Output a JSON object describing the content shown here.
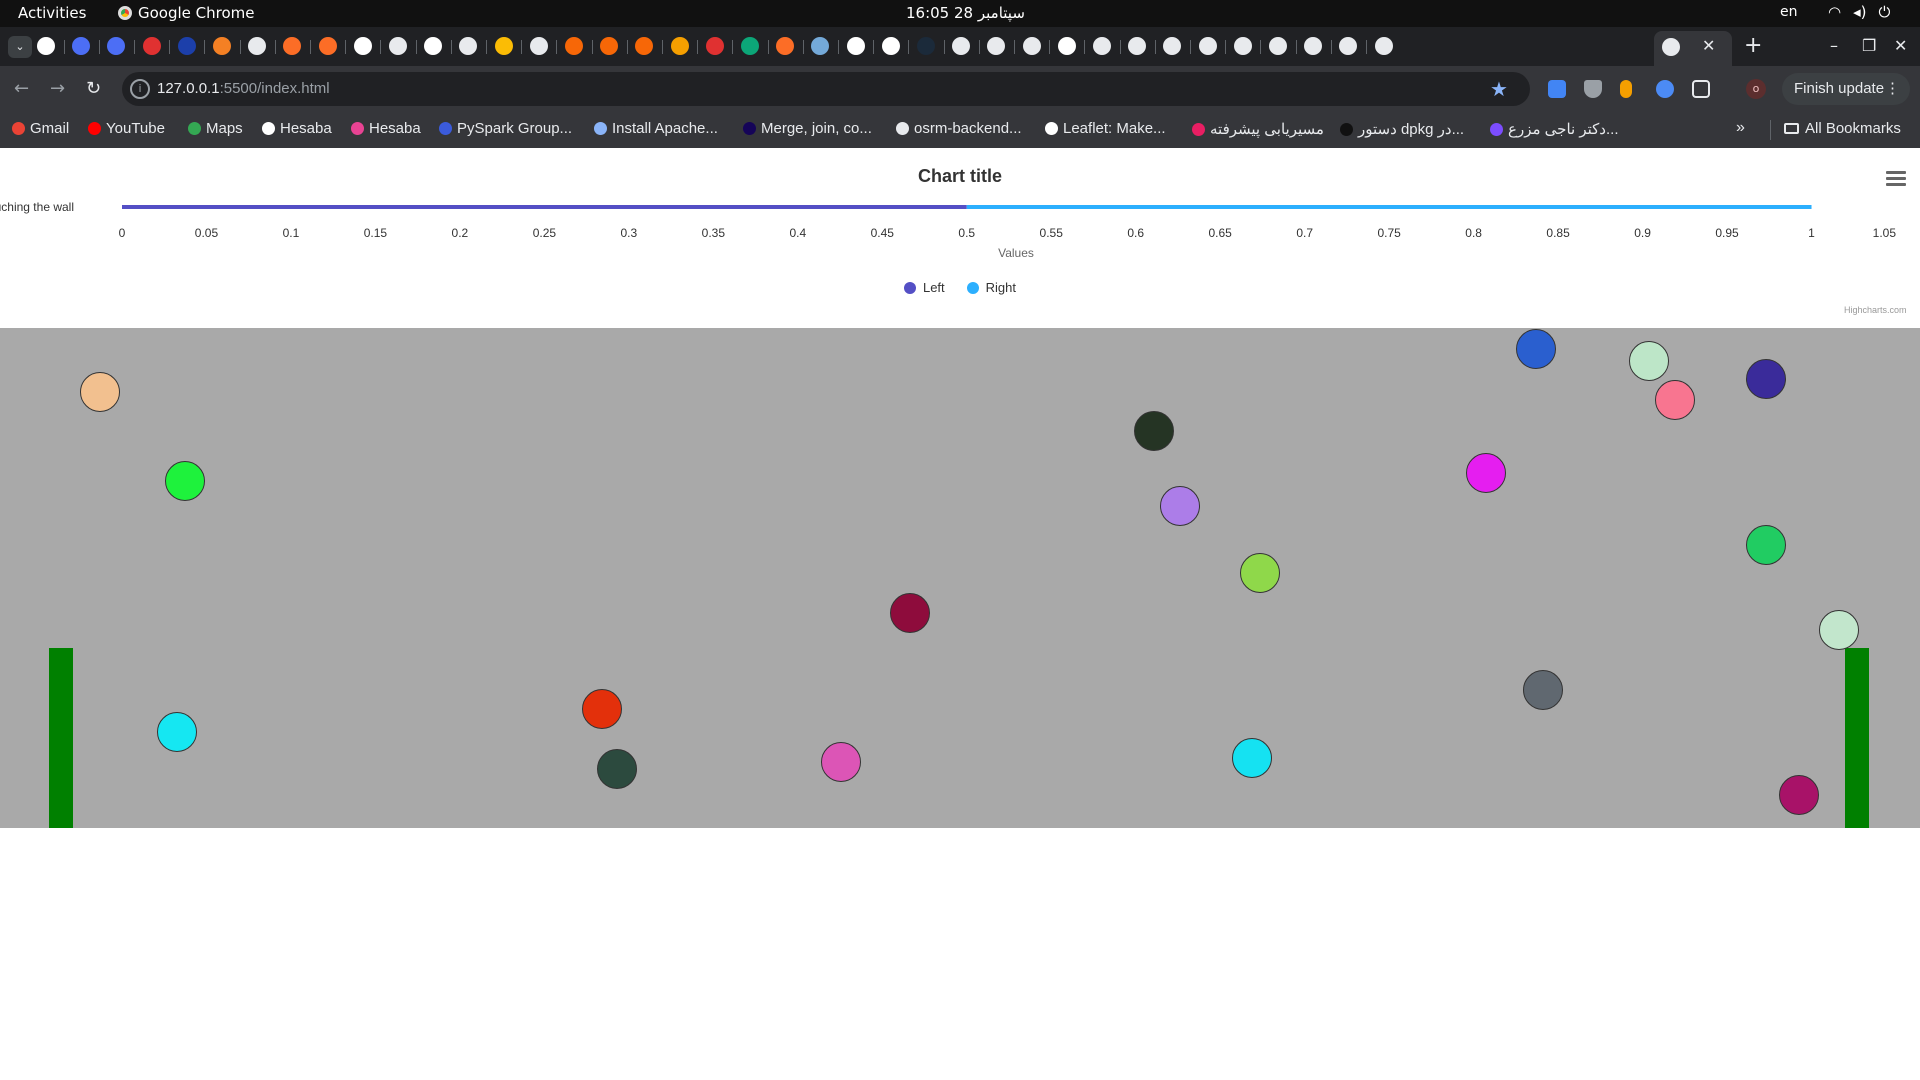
{
  "topbar": {
    "activities": "Activities",
    "app_name": "Google Chrome",
    "clock": "16:05  28 سپتامبر",
    "lang": "en"
  },
  "browser": {
    "url_host": "127.0.0.1",
    "url_rest": ":5500/index.html",
    "finish_update": "Finish update",
    "profile_letter": "o"
  },
  "bookmarks": [
    {
      "label": "Gmail",
      "color": "#ea4335"
    },
    {
      "label": "YouTube",
      "color": "#ff0000"
    },
    {
      "label": "Maps",
      "color": "#34a853"
    },
    {
      "label": "Hesaba",
      "color": "#ffffff"
    },
    {
      "label": "Hesaba",
      "color": "#e84393"
    },
    {
      "label": "PySpark Group...",
      "color": "#3b5bdb"
    },
    {
      "label": "Install Apache...",
      "color": "#8ab4f8"
    },
    {
      "label": "Merge, join, co...",
      "color": "#150458"
    },
    {
      "label": "osrm-backend...",
      "color": "#e8eaed"
    },
    {
      "label": "Leaflet: Make...",
      "color": "#ffffff"
    },
    {
      "label": "مسیریابی پیشرفته",
      "color": "#e91e63"
    },
    {
      "label": "دستور dpkg در...",
      "color": "#111111"
    },
    {
      "label": "دکتر ناجی مزرع...",
      "color": "#7c4dff"
    }
  ],
  "bookmarks_all": "All Bookmarks",
  "tabs": [
    {
      "icon": "google-icon",
      "color": "#ffffff"
    },
    {
      "icon": "blue-a-icon",
      "color": "#4c6ef5"
    },
    {
      "icon": "blue-a-icon",
      "color": "#4c6ef5"
    },
    {
      "icon": "brackets-icon",
      "color": "#e03131"
    },
    {
      "icon": "b-icon",
      "color": "#1c3faa"
    },
    {
      "icon": "stackoverflow-icon",
      "color": "#f48024"
    },
    {
      "icon": "globe-icon",
      "color": "#e8eaed"
    },
    {
      "icon": "gitlab-icon",
      "color": "#fc6d26"
    },
    {
      "icon": "gitlab-icon",
      "color": "#fc6d26"
    },
    {
      "icon": "google-icon",
      "color": "#ffffff"
    },
    {
      "icon": "globe-icon",
      "color": "#e8eaed"
    },
    {
      "icon": "google-icon",
      "color": "#ffffff"
    },
    {
      "icon": "globe-icon",
      "color": "#e8eaed"
    },
    {
      "icon": "drive-icon",
      "color": "#fbbc05"
    },
    {
      "icon": "globe-icon",
      "color": "#e8eaed"
    },
    {
      "icon": "cp-icon",
      "color": "#f76707"
    },
    {
      "icon": "cp-icon",
      "color": "#f76707"
    },
    {
      "icon": "cp-icon",
      "color": "#f76707"
    },
    {
      "icon": "arc-icon",
      "color": "#f59f00"
    },
    {
      "icon": "seven-icon",
      "color": "#e03131"
    },
    {
      "icon": "bing-icon",
      "color": "#0ca678"
    },
    {
      "icon": "gitlab-icon",
      "color": "#fc6d26"
    },
    {
      "icon": "r-icon",
      "color": "#74a9d8"
    },
    {
      "icon": "google-icon",
      "color": "#ffffff"
    },
    {
      "icon": "google-icon",
      "color": "#ffffff"
    },
    {
      "icon": "r-dark-icon",
      "color": "#1b2a3a"
    },
    {
      "icon": "globe-icon",
      "color": "#e8eaed"
    },
    {
      "icon": "openai-icon",
      "color": "#e8eaed"
    },
    {
      "icon": "github-icon",
      "color": "#e8eaed"
    },
    {
      "icon": "google-icon",
      "color": "#ffffff"
    },
    {
      "icon": "github-icon",
      "color": "#e8eaed"
    },
    {
      "icon": "github-icon",
      "color": "#e8eaed"
    },
    {
      "icon": "github-icon",
      "color": "#e8eaed"
    },
    {
      "icon": "github-icon",
      "color": "#e8eaed"
    },
    {
      "icon": "github-icon",
      "color": "#e8eaed"
    },
    {
      "icon": "github-icon",
      "color": "#e8eaed"
    },
    {
      "icon": "github-icon",
      "color": "#e8eaed"
    },
    {
      "icon": "github-icon",
      "color": "#e8eaed"
    },
    {
      "icon": "github-icon",
      "color": "#e8eaed"
    }
  ],
  "chart_data": {
    "type": "bar",
    "title": "Chart title",
    "categories": [
      "Touching the wall"
    ],
    "xlabel": "",
    "ylabel": "Values",
    "ylim": [
      0,
      1.05
    ],
    "tick_labels": [
      "0",
      "0.05",
      "0.1",
      "0.15",
      "0.2",
      "0.25",
      "0.3",
      "0.35",
      "0.4",
      "0.45",
      "0.5",
      "0.55",
      "0.6",
      "0.65",
      "0.7",
      "0.75",
      "0.8",
      "0.85",
      "0.9",
      "0.95",
      "1",
      "1.05"
    ],
    "stacking": "normal",
    "series": [
      {
        "name": "Left",
        "values": [
          0.5
        ],
        "color": "#544fc5"
      },
      {
        "name": "Right",
        "values": [
          0.5
        ],
        "color": "#2caffe"
      }
    ],
    "legend": "bottom-center",
    "credits": "Highcharts.com"
  },
  "arena": {
    "background": "#a9a9a9",
    "wall_color": "#008000",
    "balls": [
      {
        "color": "#f2c08f"
      },
      {
        "color": "#1ef23c"
      },
      {
        "color": "#15e7f2"
      },
      {
        "color": "#e3300b"
      },
      {
        "color": "#2c4a3e"
      },
      {
        "color": "#8e0c3c"
      },
      {
        "color": "#dc55b6"
      },
      {
        "color": "#253424"
      },
      {
        "color": "#ac7de8"
      },
      {
        "color": "#8fd84a"
      },
      {
        "color": "#15e2f2"
      },
      {
        "color": "#2a5fcf"
      },
      {
        "color": "#e51ef0"
      },
      {
        "color": "#606870"
      },
      {
        "color": "#bde6c8"
      },
      {
        "color": "#f87590"
      },
      {
        "color": "#3a2b9a"
      },
      {
        "color": "#21cc62"
      },
      {
        "color": "#c2e6cc"
      },
      {
        "color": "#a81268"
      }
    ]
  }
}
